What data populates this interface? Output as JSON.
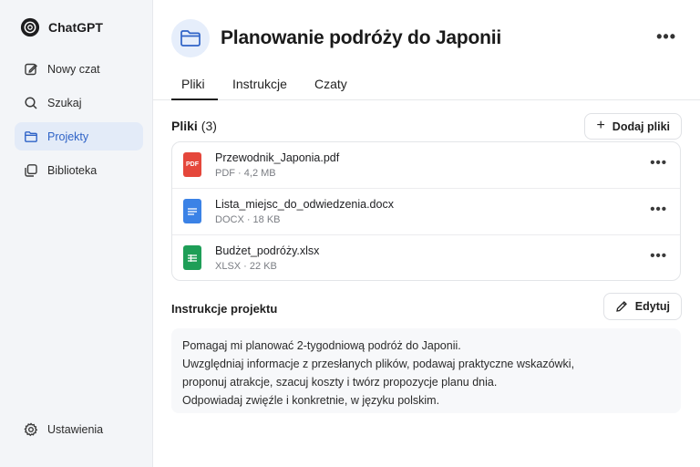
{
  "sidebar": {
    "brand": "ChatGPT",
    "items": [
      {
        "label": "Nowy czat",
        "icon": "edit-icon",
        "active": false
      },
      {
        "label": "Szukaj",
        "icon": "search-icon",
        "active": false
      },
      {
        "label": "Projekty",
        "icon": "folder-icon",
        "active": true
      },
      {
        "label": "Biblioteka",
        "icon": "library-icon",
        "active": false
      }
    ],
    "settings_label": "Ustawienia"
  },
  "header": {
    "title": "Planowanie podróży do Japonii"
  },
  "tabs": [
    {
      "label": "Pliki",
      "active": true
    },
    {
      "label": "Instrukcje",
      "active": false
    },
    {
      "label": "Czaty",
      "active": false
    }
  ],
  "files": {
    "heading": "Pliki",
    "count": "(3)",
    "add_label": "Dodaj pliki",
    "items": [
      {
        "name": "Przewodnik_Japonia.pdf",
        "meta": "PDF · 4,2 MB",
        "type": "pdf",
        "badge": "PDF",
        "color": "#e5473b"
      },
      {
        "name": "Lista_miejsc_do_odwiedzenia.docx",
        "meta": "DOCX · 18 KB",
        "type": "docx",
        "color": "#3b82e6"
      },
      {
        "name": "Budżet_podróży.xlsx",
        "meta": "XLSX · 22 KB",
        "type": "xlsx",
        "color": "#1e9e57"
      }
    ]
  },
  "instructions": {
    "heading": "Instrukcje projektu",
    "edit_label": "Edytuj",
    "lines": [
      "Pomagaj mi planować 2-tygodniową podróż do Japonii.",
      "Uwzględniaj informacje z przesłanych plików, podawaj praktyczne wskazówki,",
      "proponuj atrakcje, szacuj koszty i twórz propozycje planu dnia.",
      "Odpowiadaj zwięźle i konkretnie, w języku polskim."
    ]
  },
  "colors": {
    "accent": "#2f63c7",
    "active_bg": "#e3ebf8",
    "sidebar_bg": "#f3f5f8"
  }
}
